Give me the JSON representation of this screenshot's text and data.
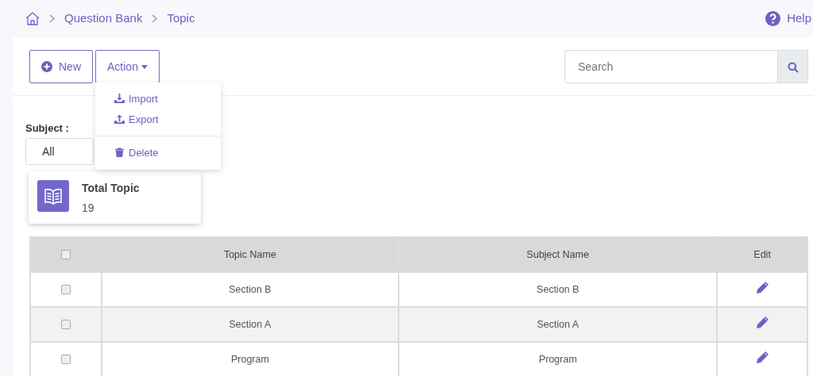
{
  "breadcrumb": [
    "Question Bank",
    "Topic"
  ],
  "help": {
    "label": "Help"
  },
  "toolbar": {
    "new_button": "New",
    "action_button": "Action",
    "search": {
      "placeholder": "Search"
    }
  },
  "action_menu": {
    "open": true,
    "items": [
      {
        "kind": "import",
        "label": "Import"
      },
      {
        "kind": "export",
        "label": "Export"
      },
      {
        "kind": "divider"
      },
      {
        "kind": "delete",
        "label": "Delete"
      }
    ]
  },
  "subject_filter": {
    "label": "Subject :",
    "value": "All"
  },
  "stat_card": {
    "title": "Total Topic",
    "value": "19"
  },
  "table": {
    "select_all": {
      "checked": false
    },
    "columns": [
      "Topic Name",
      "Subject Name",
      "Edit"
    ],
    "rows": [
      {
        "checked": false,
        "topic": "Section B",
        "subject": "Section B"
      },
      {
        "checked": false,
        "topic": "Section A",
        "subject": "Section A"
      },
      {
        "checked": false,
        "topic": "Program",
        "subject": "Program"
      }
    ]
  }
}
